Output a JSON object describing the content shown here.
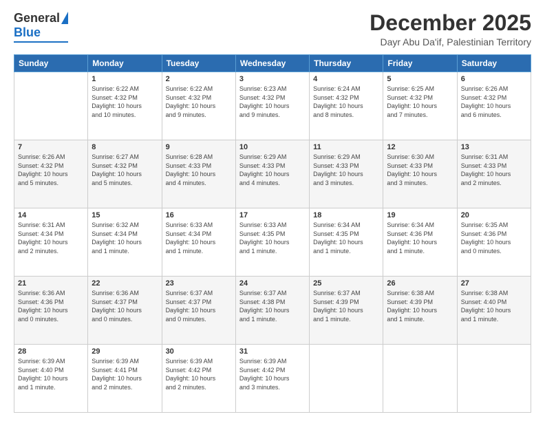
{
  "logo": {
    "general": "General",
    "blue": "Blue"
  },
  "title": "December 2025",
  "subtitle": "Dayr Abu Da'if, Palestinian Territory",
  "days": [
    "Sunday",
    "Monday",
    "Tuesday",
    "Wednesday",
    "Thursday",
    "Friday",
    "Saturday"
  ],
  "weeks": [
    [
      {
        "day": "",
        "content": ""
      },
      {
        "day": "1",
        "content": "Sunrise: 6:22 AM\nSunset: 4:32 PM\nDaylight: 10 hours\nand 10 minutes."
      },
      {
        "day": "2",
        "content": "Sunrise: 6:22 AM\nSunset: 4:32 PM\nDaylight: 10 hours\nand 9 minutes."
      },
      {
        "day": "3",
        "content": "Sunrise: 6:23 AM\nSunset: 4:32 PM\nDaylight: 10 hours\nand 9 minutes."
      },
      {
        "day": "4",
        "content": "Sunrise: 6:24 AM\nSunset: 4:32 PM\nDaylight: 10 hours\nand 8 minutes."
      },
      {
        "day": "5",
        "content": "Sunrise: 6:25 AM\nSunset: 4:32 PM\nDaylight: 10 hours\nand 7 minutes."
      },
      {
        "day": "6",
        "content": "Sunrise: 6:26 AM\nSunset: 4:32 PM\nDaylight: 10 hours\nand 6 minutes."
      }
    ],
    [
      {
        "day": "7",
        "content": "Sunrise: 6:26 AM\nSunset: 4:32 PM\nDaylight: 10 hours\nand 5 minutes."
      },
      {
        "day": "8",
        "content": "Sunrise: 6:27 AM\nSunset: 4:32 PM\nDaylight: 10 hours\nand 5 minutes."
      },
      {
        "day": "9",
        "content": "Sunrise: 6:28 AM\nSunset: 4:33 PM\nDaylight: 10 hours\nand 4 minutes."
      },
      {
        "day": "10",
        "content": "Sunrise: 6:29 AM\nSunset: 4:33 PM\nDaylight: 10 hours\nand 4 minutes."
      },
      {
        "day": "11",
        "content": "Sunrise: 6:29 AM\nSunset: 4:33 PM\nDaylight: 10 hours\nand 3 minutes."
      },
      {
        "day": "12",
        "content": "Sunrise: 6:30 AM\nSunset: 4:33 PM\nDaylight: 10 hours\nand 3 minutes."
      },
      {
        "day": "13",
        "content": "Sunrise: 6:31 AM\nSunset: 4:33 PM\nDaylight: 10 hours\nand 2 minutes."
      }
    ],
    [
      {
        "day": "14",
        "content": "Sunrise: 6:31 AM\nSunset: 4:34 PM\nDaylight: 10 hours\nand 2 minutes."
      },
      {
        "day": "15",
        "content": "Sunrise: 6:32 AM\nSunset: 4:34 PM\nDaylight: 10 hours\nand 1 minute."
      },
      {
        "day": "16",
        "content": "Sunrise: 6:33 AM\nSunset: 4:34 PM\nDaylight: 10 hours\nand 1 minute."
      },
      {
        "day": "17",
        "content": "Sunrise: 6:33 AM\nSunset: 4:35 PM\nDaylight: 10 hours\nand 1 minute."
      },
      {
        "day": "18",
        "content": "Sunrise: 6:34 AM\nSunset: 4:35 PM\nDaylight: 10 hours\nand 1 minute."
      },
      {
        "day": "19",
        "content": "Sunrise: 6:34 AM\nSunset: 4:36 PM\nDaylight: 10 hours\nand 1 minute."
      },
      {
        "day": "20",
        "content": "Sunrise: 6:35 AM\nSunset: 4:36 PM\nDaylight: 10 hours\nand 0 minutes."
      }
    ],
    [
      {
        "day": "21",
        "content": "Sunrise: 6:36 AM\nSunset: 4:36 PM\nDaylight: 10 hours\nand 0 minutes."
      },
      {
        "day": "22",
        "content": "Sunrise: 6:36 AM\nSunset: 4:37 PM\nDaylight: 10 hours\nand 0 minutes."
      },
      {
        "day": "23",
        "content": "Sunrise: 6:37 AM\nSunset: 4:37 PM\nDaylight: 10 hours\nand 0 minutes."
      },
      {
        "day": "24",
        "content": "Sunrise: 6:37 AM\nSunset: 4:38 PM\nDaylight: 10 hours\nand 1 minute."
      },
      {
        "day": "25",
        "content": "Sunrise: 6:37 AM\nSunset: 4:39 PM\nDaylight: 10 hours\nand 1 minute."
      },
      {
        "day": "26",
        "content": "Sunrise: 6:38 AM\nSunset: 4:39 PM\nDaylight: 10 hours\nand 1 minute."
      },
      {
        "day": "27",
        "content": "Sunrise: 6:38 AM\nSunset: 4:40 PM\nDaylight: 10 hours\nand 1 minute."
      }
    ],
    [
      {
        "day": "28",
        "content": "Sunrise: 6:39 AM\nSunset: 4:40 PM\nDaylight: 10 hours\nand 1 minute."
      },
      {
        "day": "29",
        "content": "Sunrise: 6:39 AM\nSunset: 4:41 PM\nDaylight: 10 hours\nand 2 minutes."
      },
      {
        "day": "30",
        "content": "Sunrise: 6:39 AM\nSunset: 4:42 PM\nDaylight: 10 hours\nand 2 minutes."
      },
      {
        "day": "31",
        "content": "Sunrise: 6:39 AM\nSunset: 4:42 PM\nDaylight: 10 hours\nand 3 minutes."
      },
      {
        "day": "",
        "content": ""
      },
      {
        "day": "",
        "content": ""
      },
      {
        "day": "",
        "content": ""
      }
    ]
  ]
}
